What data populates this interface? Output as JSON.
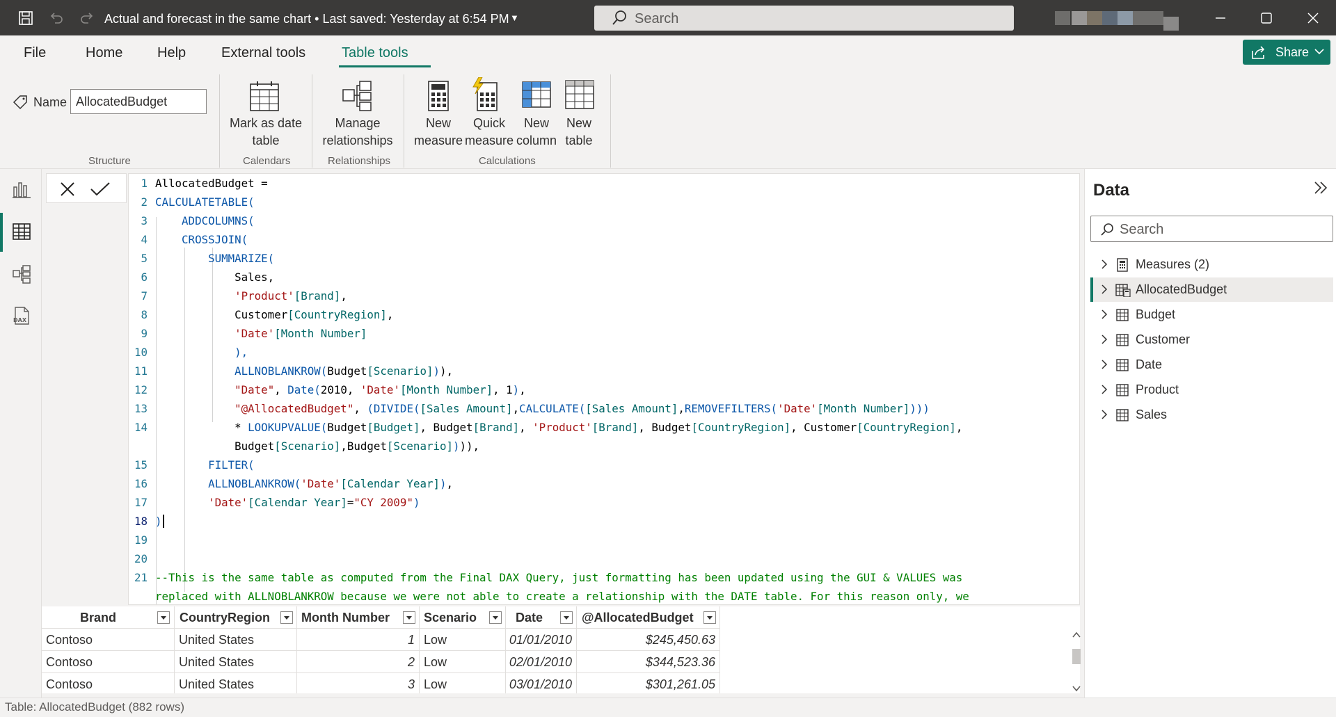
{
  "titlebar": {
    "title": "Actual and forecast in the same chart • Last saved: Yesterday at 6:54 PM",
    "search_placeholder": "Search"
  },
  "menu": {
    "items": [
      "File",
      "Home",
      "Help",
      "External tools",
      "Table tools"
    ],
    "active": "Table tools",
    "share_label": "Share"
  },
  "ribbon": {
    "name_label": "Name",
    "name_value": "AllocatedBudget",
    "mark_date_line1": "Mark as date",
    "mark_date_line2": "table",
    "manage_rel_line1": "Manage",
    "manage_rel_line2": "relationships",
    "new_measure_line1": "New",
    "new_measure_line2": "measure",
    "quick_measure_line1": "Quick",
    "quick_measure_line2": "measure",
    "new_column_line1": "New",
    "new_column_line2": "column",
    "new_table_line1": "New",
    "new_table_line2": "table",
    "groups": {
      "structure": "Structure",
      "calendars": "Calendars",
      "relationships": "Relationships",
      "calculations": "Calculations"
    }
  },
  "editor": {
    "line_numbers": [
      "1",
      "2",
      "3",
      "4",
      "5",
      "6",
      "7",
      "8",
      "9",
      "10",
      "11",
      "12",
      "13",
      "14",
      "",
      "15",
      "16",
      "17",
      "18",
      "19",
      "20",
      "21",
      ""
    ],
    "current_line": "18",
    "lines": [
      "AllocatedBudget =",
      "CALCULATETABLE(",
      "    ADDCOLUMNS(",
      "    CROSSJOIN(",
      "        SUMMARIZE(",
      "            Sales,",
      "            'Product'[Brand],",
      "            Customer[CountryRegion],",
      "            'Date'[Month Number]",
      "            ),",
      "            ALLNOBLANKROW(Budget[Scenario])),",
      "            \"Date\", Date(2010, 'Date'[Month Number], 1),",
      "            \"@AllocatedBudget\", (DIVIDE([Sales Amount],CALCULATE([Sales Amount],REMOVEFILTERS('Date'[Month Number])))",
      "            * LOOKUPVALUE(Budget[Budget], Budget[Brand], 'Product'[Brand], Budget[CountryRegion], Customer[CountryRegion],",
      "            Budget[Scenario],Budget[Scenario]))),",
      "        FILTER(",
      "        ALLNOBLANKROW('Date'[Calendar Year]),",
      "        'Date'[Calendar Year]=\"CY 2009\")",
      ")",
      "",
      "",
      "--This is the same table as computed from the Final DAX Query, just formatting has been updated using the GUI & VALUES was",
      "replaced with ALLNOBLANKROW because we were not able to create a relationship with the DATE table. For this reason only, we"
    ]
  },
  "grid": {
    "columns": [
      "Brand",
      "CountryRegion",
      "Month Number",
      "Scenario",
      "Date",
      "@AllocatedBudget"
    ],
    "rows": [
      [
        "Contoso",
        "United States",
        "1",
        "Low",
        "01/01/2010",
        "$245,450.63"
      ],
      [
        "Contoso",
        "United States",
        "2",
        "Low",
        "02/01/2010",
        "$344,523.36"
      ],
      [
        "Contoso",
        "United States",
        "3",
        "Low",
        "03/01/2010",
        "$301,261.05"
      ]
    ]
  },
  "status": {
    "text": "Table: AllocatedBudget (882 rows)"
  },
  "data_pane": {
    "title": "Data",
    "search_placeholder": "Search",
    "items": [
      {
        "label": "Measures (2)",
        "icon": "calculator-icon"
      },
      {
        "label": "AllocatedBudget",
        "icon": "calculated-table-icon",
        "selected": true
      },
      {
        "label": "Budget",
        "icon": "table-icon"
      },
      {
        "label": "Customer",
        "icon": "table-icon"
      },
      {
        "label": "Date",
        "icon": "table-icon"
      },
      {
        "label": "Product",
        "icon": "table-icon"
      },
      {
        "label": "Sales",
        "icon": "table-icon"
      }
    ]
  },
  "colors": {
    "accent": "#117865",
    "titlebar": "#3b3a39",
    "keyword": "#0b56a8",
    "string": "#a31515",
    "comment": "#008000"
  }
}
